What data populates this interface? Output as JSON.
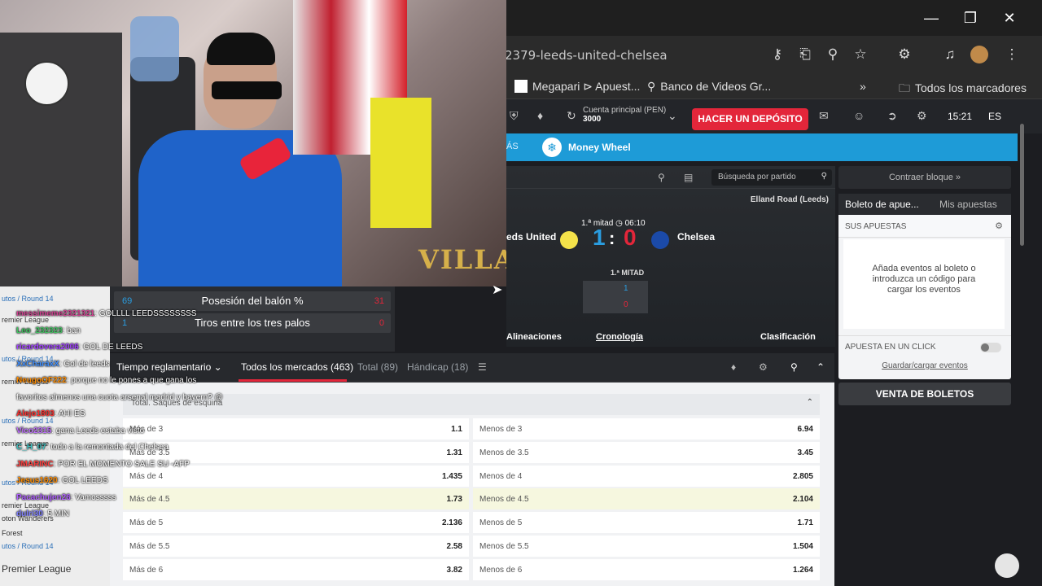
{
  "window": {
    "minimize_icon": "minimize-icon",
    "restore_icon": "restore-icon",
    "close_icon": "close-icon"
  },
  "browser": {
    "url": "2379-leeds-united-chelsea",
    "bookmarks": [
      {
        "label": "Megapari ⊳ Apuest...",
        "icon": "square-icon"
      },
      {
        "label": "Banco de Videos Gr...",
        "icon": "pin-icon"
      }
    ],
    "bookmarks_more": "»",
    "all_bookmarks": "Todos los marcadores"
  },
  "header": {
    "account_label": "Cuenta principal (PEN)",
    "account_value": "3000",
    "deposit_button": "HACER UN DEPÓSITO",
    "time": "15:21",
    "language": "ES"
  },
  "blue_nav": {
    "more": "ÁS",
    "item": "Money Wheel"
  },
  "match": {
    "search_placeholder": "Búsqueda por partido",
    "stadium": "Elland Road (Leeds)",
    "period": "1.ª mitad",
    "clock": "06:10",
    "home": "eds United",
    "away": "Chelsea",
    "home_score": "1",
    "sep": ":",
    "away_score": "0",
    "half_label": "1.ª MITAD",
    "half_home": "1",
    "half_away": "0",
    "lineups": "Alineaciones",
    "chronology": "Cronología",
    "standings": "Clasificación"
  },
  "betslip": {
    "collapse": "Contraer bloque »",
    "tab_slip": "Boleto de apue...",
    "tab_my": "Mis apuestas",
    "your_bets": "SUS APUESTAS",
    "empty": "Añada eventos al boleto o introduzca un código para cargar los eventos",
    "one_click": "APUESTA EN UN CLICK",
    "save_load": "Guardar/cargar eventos",
    "sell": "VENTA DE BOLETOS"
  },
  "market_tabs": {
    "time": "Tiempo reglamentario",
    "all": "Todos los mercados (463)",
    "total": "Total (89)",
    "handicap": "Hándicap (18)"
  },
  "market": {
    "header": "Total. Saques de esquina",
    "rows": [
      {
        "over": "Más de 3",
        "over_odd": "1.1",
        "under": "Menos de 3",
        "under_odd": "6.94"
      },
      {
        "over": "Más de 3.5",
        "over_odd": "1.31",
        "under": "Menos de 3.5",
        "under_odd": "3.45"
      },
      {
        "over": "Más de 4",
        "over_odd": "1.435",
        "under": "Menos de 4",
        "under_odd": "2.805"
      },
      {
        "over": "Más de 4.5",
        "over_odd": "1.73",
        "under": "Menos de 4.5",
        "under_odd": "2.104"
      },
      {
        "over": "Más de 5",
        "over_odd": "2.136",
        "under": "Menos de 5",
        "under_odd": "1.71"
      },
      {
        "over": "Más de 5.5",
        "over_odd": "2.58",
        "under": "Menos de 5.5",
        "under_odd": "1.504"
      },
      {
        "over": "Más de 6",
        "over_odd": "3.82",
        "under": "Menos de 6",
        "under_odd": "1.264"
      }
    ]
  },
  "stats": {
    "possession_label": "Posesión del balón %",
    "possession_home": "69",
    "possession_away": "31",
    "shots_label": "Tiros entre los tres palos",
    "shots_home": "1",
    "shots_away": "0"
  },
  "stream": {
    "logo_text": "VILLA"
  },
  "left_list": [
    "utos / Round 14",
    "remier League",
    "utos / Round 14",
    "remier League",
    "utos / Round 14",
    "remier League",
    "utos / Round 14",
    "remier League",
    "oton Wanderers",
    "Forest",
    "utos / Round 14",
    "Premier League"
  ],
  "chat": [
    {
      "user": "messimeme2321321",
      "msg": ": GOLLLL LEEDSSSSSSSS"
    },
    {
      "user": "Leo_232323",
      "msg": ": ban"
    },
    {
      "user": "ricardovera2006",
      "msg": ": GOL DE LEEDS"
    },
    {
      "user": "XxCharaxX",
      "msg": ": Gol de leeds"
    },
    {
      "user": "NeugoOF222",
      "msg": ": porque no le pones a que gana los"
    },
    {
      "user": "",
      "msg": "favoritos almenos una cuota arsenal madrid y bayern? @"
    },
    {
      "user": "Alejo1803",
      "msg": ": AHI ES"
    },
    {
      "user": "Vico2315",
      "msg": ": gana Leeds estaba visto"
    },
    {
      "user": "C_H_07",
      "msg": ": todo a la remontada del Chelsea"
    },
    {
      "user": "JMARINC",
      "msg": ": POR EL MOMENTO SALE SU -AFP"
    },
    {
      "user": "Jesus1620",
      "msg": ": GOL LEEDS"
    },
    {
      "user": "Pacachujen26",
      "msg": ": Vamosssss"
    },
    {
      "user": "dulri30",
      "msg": ": 5 MIN"
    }
  ],
  "colors": {
    "deposit": "#e3263a",
    "blue_nav": "#1e9bd7",
    "score_home": "#2a9de0",
    "score_away": "#e3263a"
  }
}
